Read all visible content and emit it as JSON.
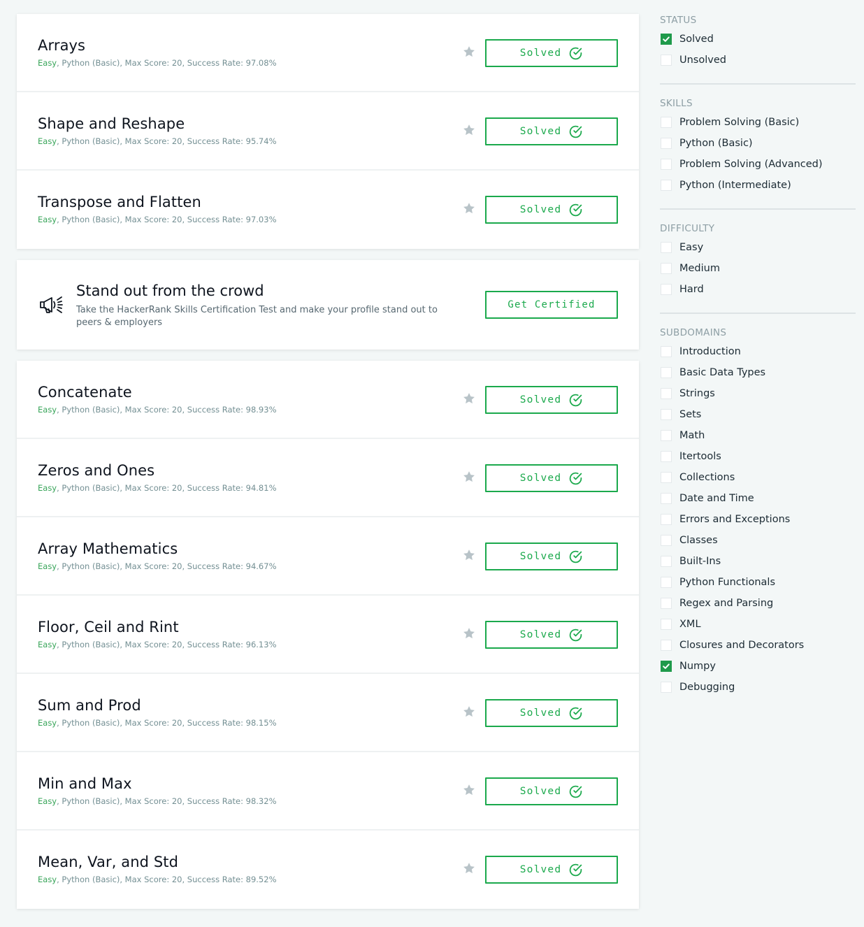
{
  "colors": {
    "accent": "#1ba94c",
    "difficulty_easy": "#39a55a",
    "star": "#b8c3c8"
  },
  "challenges_top": [
    {
      "title": "Arrays",
      "difficulty": "Easy",
      "details": ", Python (Basic), Max Score: 20, Success Rate: 97.08%",
      "button": "Solved"
    },
    {
      "title": "Shape and Reshape",
      "difficulty": "Easy",
      "details": ", Python (Basic), Max Score: 20, Success Rate: 95.74%",
      "button": "Solved"
    },
    {
      "title": "Transpose and Flatten",
      "difficulty": "Easy",
      "details": ", Python (Basic), Max Score: 20, Success Rate: 97.03%",
      "button": "Solved"
    }
  ],
  "promo": {
    "icon": "megaphone-icon",
    "title": "Stand out from the crowd",
    "description": "Take the HackerRank Skills Certification Test and make your profile stand out to peers & employers",
    "button": "Get Certified"
  },
  "challenges_bottom": [
    {
      "title": "Concatenate",
      "difficulty": "Easy",
      "details": ", Python (Basic), Max Score: 20, Success Rate: 98.93%",
      "button": "Solved"
    },
    {
      "title": "Zeros and Ones",
      "difficulty": "Easy",
      "details": ", Python (Basic), Max Score: 20, Success Rate: 94.81%",
      "button": "Solved"
    },
    {
      "title": "Array Mathematics",
      "difficulty": "Easy",
      "details": ", Python (Basic), Max Score: 20, Success Rate: 94.67%",
      "button": "Solved"
    },
    {
      "title": "Floor, Ceil and Rint",
      "difficulty": "Easy",
      "details": ", Python (Basic), Max Score: 20, Success Rate: 96.13%",
      "button": "Solved"
    },
    {
      "title": "Sum and Prod",
      "difficulty": "Easy",
      "details": ", Python (Basic), Max Score: 20, Success Rate: 98.15%",
      "button": "Solved"
    },
    {
      "title": "Min and Max",
      "difficulty": "Easy",
      "details": ", Python (Basic), Max Score: 20, Success Rate: 98.32%",
      "button": "Solved"
    },
    {
      "title": "Mean, Var, and Std",
      "difficulty": "Easy",
      "details": ", Python (Basic), Max Score: 20, Success Rate: 89.52%",
      "button": "Solved"
    }
  ],
  "filters": [
    {
      "heading": "STATUS",
      "options": [
        {
          "label": "Solved",
          "checked": true
        },
        {
          "label": "Unsolved",
          "checked": false
        }
      ]
    },
    {
      "heading": "SKILLS",
      "options": [
        {
          "label": "Problem Solving (Basic)",
          "checked": false
        },
        {
          "label": "Python (Basic)",
          "checked": false
        },
        {
          "label": "Problem Solving (Advanced)",
          "checked": false
        },
        {
          "label": "Python (Intermediate)",
          "checked": false
        }
      ]
    },
    {
      "heading": "DIFFICULTY",
      "options": [
        {
          "label": "Easy",
          "checked": false
        },
        {
          "label": "Medium",
          "checked": false
        },
        {
          "label": "Hard",
          "checked": false
        }
      ]
    },
    {
      "heading": "SUBDOMAINS",
      "options": [
        {
          "label": "Introduction",
          "checked": false
        },
        {
          "label": "Basic Data Types",
          "checked": false
        },
        {
          "label": "Strings",
          "checked": false
        },
        {
          "label": "Sets",
          "checked": false
        },
        {
          "label": "Math",
          "checked": false
        },
        {
          "label": "Itertools",
          "checked": false
        },
        {
          "label": "Collections",
          "checked": false
        },
        {
          "label": "Date and Time",
          "checked": false
        },
        {
          "label": "Errors and Exceptions",
          "checked": false
        },
        {
          "label": "Classes",
          "checked": false
        },
        {
          "label": "Built-Ins",
          "checked": false
        },
        {
          "label": "Python Functionals",
          "checked": false
        },
        {
          "label": "Regex and Parsing",
          "checked": false
        },
        {
          "label": "XML",
          "checked": false
        },
        {
          "label": "Closures and Decorators",
          "checked": false
        },
        {
          "label": "Numpy",
          "checked": true
        },
        {
          "label": "Debugging",
          "checked": false
        }
      ]
    }
  ]
}
